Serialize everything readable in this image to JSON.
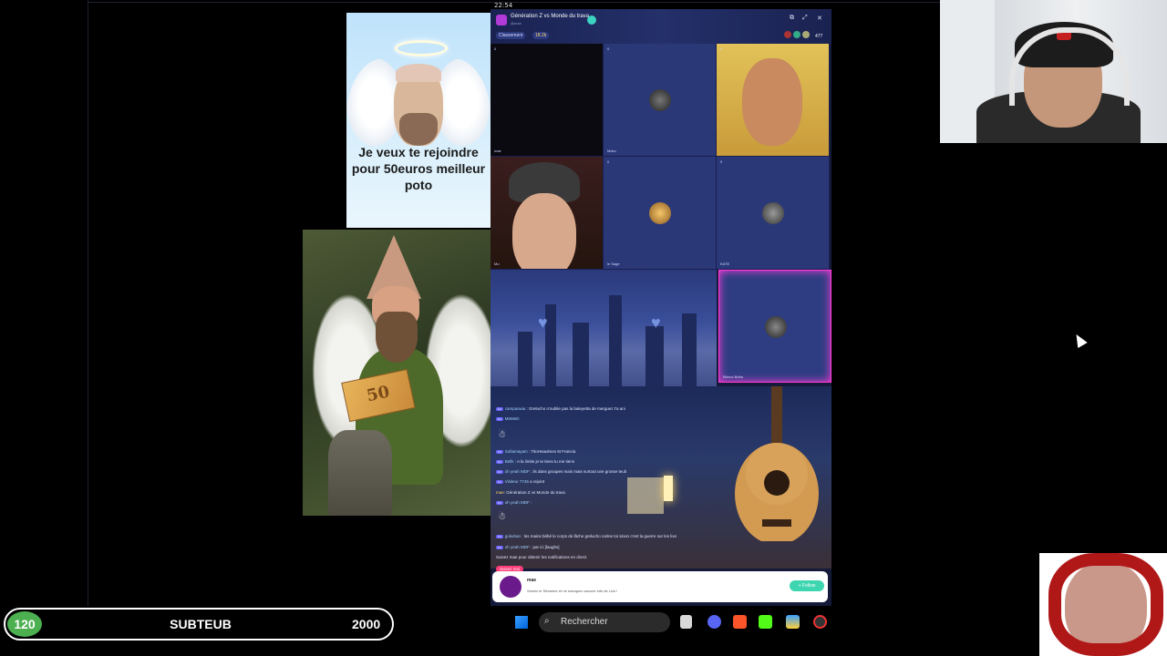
{
  "clock": "22:54",
  "angel_card": {
    "caption": "Je veux te rejoindre pour 50euros meilleur poto"
  },
  "gnome_card": {
    "banknote_value": "50"
  },
  "live": {
    "title": "Génération Z vs Monde du trava",
    "subtitle": "@mae",
    "rank_label": "Classement",
    "score": "18.2k",
    "viewers": "477",
    "tiles": [
      {
        "name": "mae",
        "num": "0"
      },
      {
        "name": "Meko",
        "num": "0"
      },
      {
        "name": "",
        "num": "0"
      },
      {
        "name": "Mo",
        "num": "0"
      },
      {
        "name": "le Sage",
        "num": "0"
      },
      {
        "name": "KATE",
        "num": "0"
      },
      {
        "name": "Bilecci Belta",
        "num": "0"
      }
    ],
    "chat": [
      {
        "user": "campaswia",
        "text": "Grelucho n'oublie pas la baleyetta de merguez t'a ani"
      },
      {
        "user": "MeMeD",
        "text": ""
      },
      {
        "user": "Sofiamayam",
        "text": "TitoHeaulmes 6t Francia"
      },
      {
        "user": "Bellk",
        "text": "A la limite je te tiens tu me tiens"
      },
      {
        "user": "oh yeah MDF",
        "text": "ils dans groupes mais mais surtout une grosse teub"
      },
      {
        "user": "Visiteur 7745",
        "text": "a rejoint"
      },
      {
        "user": "mae",
        "text": "Génération Z vs Monde du trava"
      },
      {
        "user": "oh yeah MDF",
        "text": ""
      },
      {
        "user": "gokuhan",
        "text": "les mains bébé le corps de lâche grelucho calme toi sinon c'est la guerre sur les live"
      },
      {
        "user": "oh yeah MDF",
        "text": "par ici [laughs]"
      },
      {
        "user": "",
        "text": "Suivez mae pour obtenir les notifications en direct"
      }
    ],
    "follow_label": "Suivez moi",
    "notification": {
      "name": "mae",
      "text": "Suivez le Streamer et ne manquez aucune info de Live !",
      "button": "+ Follow"
    }
  },
  "sub_bar": {
    "count": "120",
    "label": "SUBTEUB",
    "goal": "2000"
  },
  "taskbar": {
    "search_placeholder": "Rechercher"
  }
}
